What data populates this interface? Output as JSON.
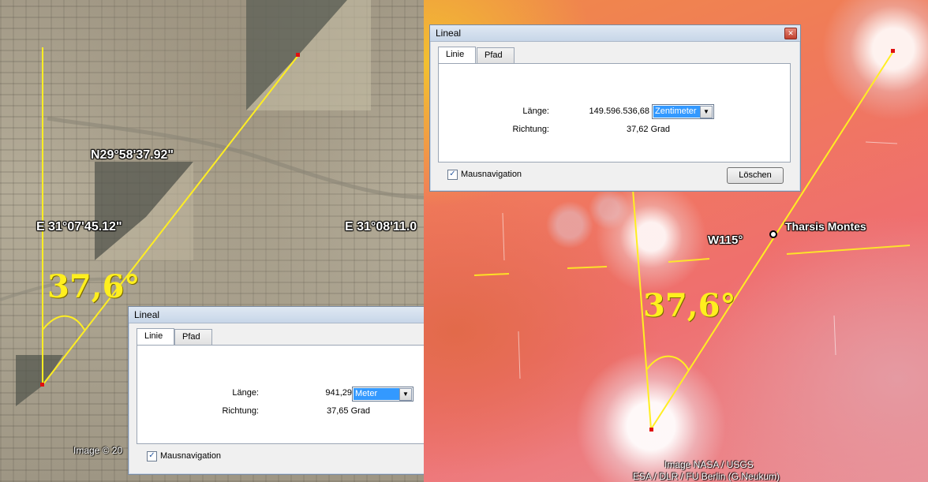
{
  "left_view": {
    "latitude_label": "N29°58'37.92\"",
    "longitude_label_west": "E 31°07'45.12\"",
    "longitude_label_east": "E 31°08'11.0",
    "angle_label": "37,6°",
    "credit": "Image © 20"
  },
  "right_view": {
    "longitude_label": "W115°",
    "place_label": "Tharsis Montes",
    "angle_label": "37,6°",
    "credit_line1": "Image NASA / USGS",
    "credit_line2": "ESA / DLR / FU Berlin (G.Neukum)"
  },
  "ruler_left": {
    "title": "Lineal",
    "tabs": [
      "Linie",
      "Pfad"
    ],
    "length_label": "Länge:",
    "length_value": "941,29",
    "unit": "Meter",
    "direction_label": "Richtung:",
    "direction_value": "37,65 Grad",
    "mouse_nav_label": "Mausnavigation",
    "mouse_nav_checked": true
  },
  "ruler_right": {
    "title": "Lineal",
    "tabs": [
      "Linie",
      "Pfad"
    ],
    "length_label": "Länge:",
    "length_value": "149.596.536,68",
    "unit": "Zentimeter",
    "direction_label": "Richtung:",
    "direction_value": "37,62 Grad",
    "mouse_nav_label": "Mausnavigation",
    "mouse_nav_checked": true,
    "clear_label": "Löschen"
  },
  "icons": {
    "close": "close-icon",
    "check": "check-icon",
    "dropdown": "chevron-down-icon"
  },
  "colors": {
    "measure_line": "#ffee22",
    "selection": "#3399ff"
  }
}
